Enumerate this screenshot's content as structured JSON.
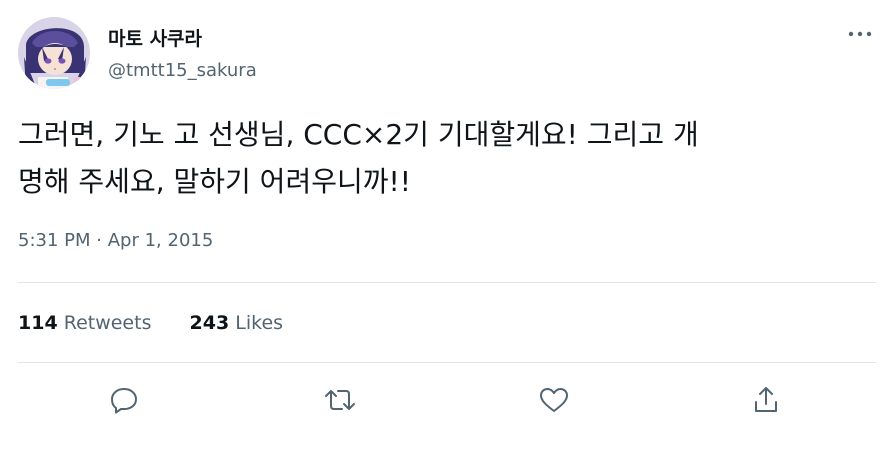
{
  "tweet": {
    "author": {
      "display_name": "마토 사쿠라",
      "handle": "@tmtt15_sakura"
    },
    "text": "그러면, 기노 고 선생님, CCC×2기 기대할게요! 그리고 개\n명해 주세요, 말하기 어려우니까!!",
    "timestamp": {
      "time": "5:31 PM",
      "separator": "·",
      "date": "Apr 1, 2015"
    },
    "stats": {
      "retweets_count": "114",
      "retweets_label": "Retweets",
      "likes_count": "243",
      "likes_label": "Likes"
    }
  },
  "icons": {
    "more": "more-horizontal-icon",
    "reply": "reply-icon",
    "retweet": "retweet-icon",
    "like": "heart-icon",
    "share": "share-icon"
  },
  "colors": {
    "text_primary": "#0f1419",
    "text_secondary": "#536471",
    "divider": "#e3e7ea"
  }
}
